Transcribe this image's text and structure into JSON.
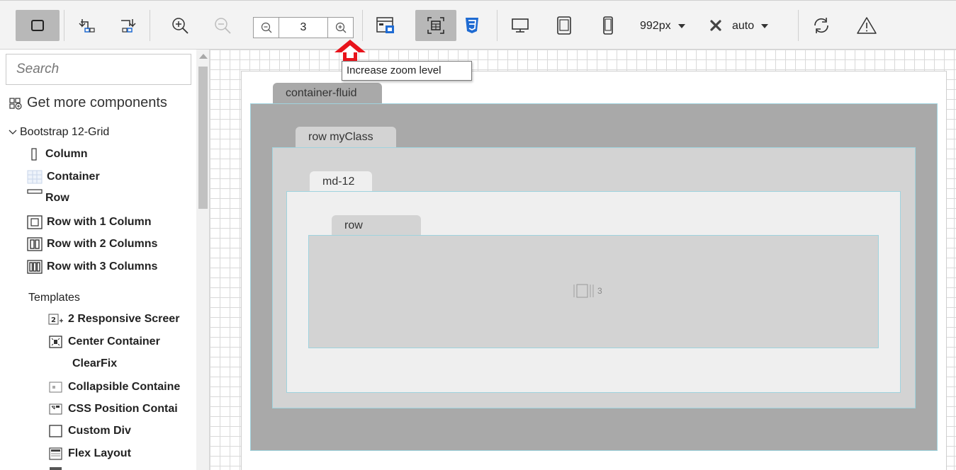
{
  "toolbar": {
    "zoom_value": "3",
    "width_value": "992px",
    "height_value": "auto",
    "tooltip": "Increase zoom level"
  },
  "sidebar": {
    "search_placeholder": "Search",
    "get_more": "Get more components",
    "group": "Bootstrap 12-Grid",
    "components": [
      "Column",
      "Container",
      "Row",
      "Row with 1 Column",
      "Row with 2 Columns",
      "Row with 3 Columns"
    ],
    "templates_label": "Templates",
    "templates": [
      "2 Responsive Screer",
      "Center Container",
      "ClearFix",
      "Collapsible Containe",
      "CSS Position Contai",
      "Custom Div",
      "Flex Layout"
    ]
  },
  "canvas": {
    "container_label": "container-fluid",
    "row_label": "row myClass",
    "col_label": "md-12",
    "inner_row_label": "row",
    "row_count": "3"
  },
  "colors": {
    "container_fluid": "#a9a9a9",
    "row": "#d3d3d3",
    "column": "#efefef",
    "inner_row": "#d3d3d3",
    "border": "#9fd3de",
    "arrow": "#e8131b",
    "accent_css": "#1f6bd2"
  }
}
